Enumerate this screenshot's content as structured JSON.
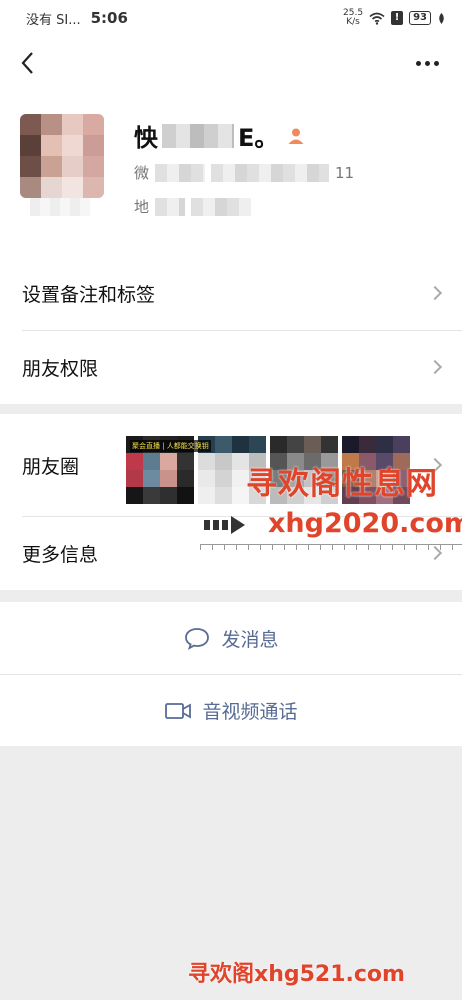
{
  "status_bar": {
    "carrier": "没有 SI...",
    "time": "5:06",
    "net_speed_value": "25.5",
    "net_speed_unit": "K/s",
    "alert_mark": "!",
    "battery": "93"
  },
  "profile": {
    "name_start": "怏",
    "name_end": "E。",
    "line1_prefix": "微",
    "line1_suffix": "11",
    "line2_prefix": "地"
  },
  "menu": {
    "remark_tags": "设置备注和标签",
    "friend_permissions": "朋友权限",
    "moments": "朋友圈",
    "more_info": "更多信息"
  },
  "moments_thumb_caption": "聚会直播 | 人都能交换钥",
  "actions": {
    "send_message": "发消息",
    "voice_video_call": "音视频通话"
  },
  "watermarks": {
    "site_cn": "寻欢阁性息网",
    "site_domain": "xhg2020.com",
    "bottom": "寻欢阁xhg521.com"
  },
  "colors": {
    "link_blue": "#576b95",
    "watermark_red": "#e0442a",
    "contact_badge_orange": "#f08a5d"
  },
  "icons": [
    "back-arrow-icon",
    "more-dots-icon",
    "person-icon",
    "chevron-right-icon",
    "chat-bubble-icon",
    "video-camera-icon",
    "wifi-icon",
    "signal-alert-icon",
    "battery-icon",
    "leaf-icon"
  ]
}
